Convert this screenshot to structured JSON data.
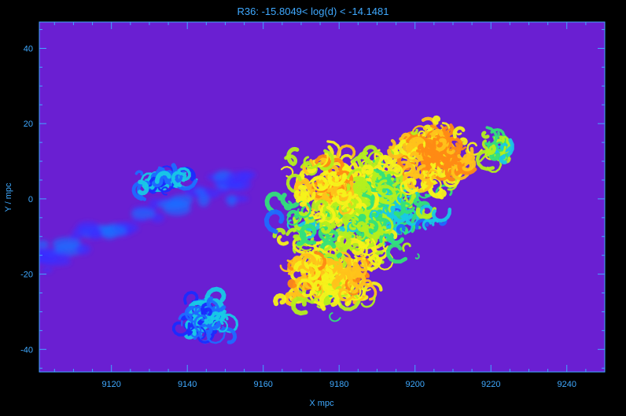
{
  "colors": {
    "background": "#000000",
    "frame": "#3fa9ff",
    "plot_fill": "#6a1fd2",
    "palette": [
      "#1a2cff",
      "#1e6bff",
      "#18c9e6",
      "#33e07a",
      "#b4ef1e",
      "#f5f21a",
      "#ffc21a",
      "#ff8a14"
    ]
  },
  "chart_data": {
    "type": "heatmap",
    "title": "R36: -15.8049< log(d) < -14.1481",
    "xlabel": "X  mpc",
    "ylabel": "Y / mpc",
    "xlim": [
      9101,
      9250
    ],
    "ylim": [
      -46,
      47
    ],
    "xticks": [
      9120,
      9140,
      9160,
      9180,
      9200,
      9220,
      9240
    ],
    "yticks": [
      -40,
      -20,
      0,
      20,
      40
    ],
    "xtick_labels": [
      "9120",
      "9140",
      "9160",
      "9180",
      "9200",
      "9220",
      "9240"
    ],
    "ytick_labels": [
      "-40",
      "-20",
      "0",
      "20",
      "40"
    ],
    "grid": false,
    "colorscale": "rainbow",
    "value_range": [
      -15.8049,
      -14.1481
    ]
  }
}
